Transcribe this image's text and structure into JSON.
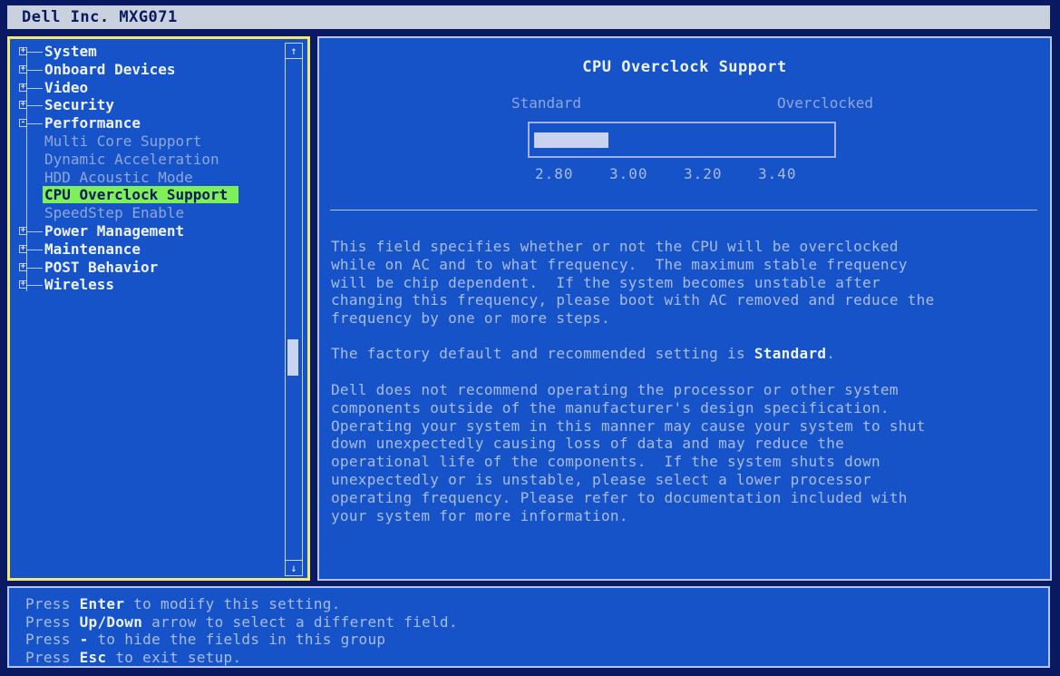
{
  "window": {
    "title": "Dell Inc. MXG071"
  },
  "tree": {
    "items": [
      {
        "label": "System",
        "type": "group",
        "expander": "+"
      },
      {
        "label": "Onboard Devices",
        "type": "group",
        "expander": "+"
      },
      {
        "label": "Video",
        "type": "group",
        "expander": "+"
      },
      {
        "label": "Security",
        "type": "group",
        "expander": "+"
      },
      {
        "label": "Performance",
        "type": "group",
        "expander": "-"
      },
      {
        "label": "Multi Core Support",
        "type": "child"
      },
      {
        "label": "Dynamic Acceleration",
        "type": "child"
      },
      {
        "label": "HDD Acoustic Mode",
        "type": "child"
      },
      {
        "label": "CPU Overclock Support",
        "type": "child",
        "selected": true
      },
      {
        "label": "SpeedStep Enable",
        "type": "child"
      },
      {
        "label": "Power Management",
        "type": "group",
        "expander": "+"
      },
      {
        "label": "Maintenance",
        "type": "group",
        "expander": "+"
      },
      {
        "label": "POST Behavior",
        "type": "group",
        "expander": "+"
      },
      {
        "label": "Wireless",
        "type": "group",
        "expander": "+"
      }
    ],
    "scroll_up_icon": "↑",
    "scroll_down_icon": "↓",
    "scroll_position": 0.6
  },
  "setting": {
    "title": "CPU Overclock Support",
    "min_label": "Standard",
    "max_label": "Overclocked",
    "ticks": [
      "2.80",
      "3.00",
      "3.20",
      "3.40"
    ],
    "current_fraction": 0.25,
    "description_paragraphs": [
      "This field specifies whether or not the CPU will be overclocked\nwhile on AC and to what frequency.  The maximum stable frequency\nwill be chip dependent.  If the system becomes unstable after\nchanging this frequency, please boot with AC removed and reduce the\nfrequency by one or more steps.",
      "Dell does not recommend operating the processor or other system\ncomponents outside of the manufacturer's design specification.\nOperating your system in this manner may cause your system to shut\ndown unexpectedly causing loss of data and may reduce the\noperational life of the components.  If the system shuts down\nunexpectedly or is unstable, please select a lower processor\noperating frequency. Please refer to documentation included with\nyour system for more information."
    ],
    "default_prefix": "The factory default and recommended setting is ",
    "default_value": "Standard",
    "default_suffix": "."
  },
  "help": [
    {
      "pre": "Press ",
      "key": "Enter",
      "post": " to modify this setting."
    },
    {
      "pre": "Press ",
      "key": "Up/Down",
      "post": " arrow to select a different field."
    },
    {
      "pre": "Press ",
      "key": "-",
      "post": " to hide the fields in this group"
    },
    {
      "pre": "Press ",
      "key": "Esc",
      "post": " to exit setup."
    }
  ],
  "colors": {
    "panel_bg": "#1653c9",
    "selection_bg": "#7df05a",
    "focus_border": "#f3e870"
  }
}
